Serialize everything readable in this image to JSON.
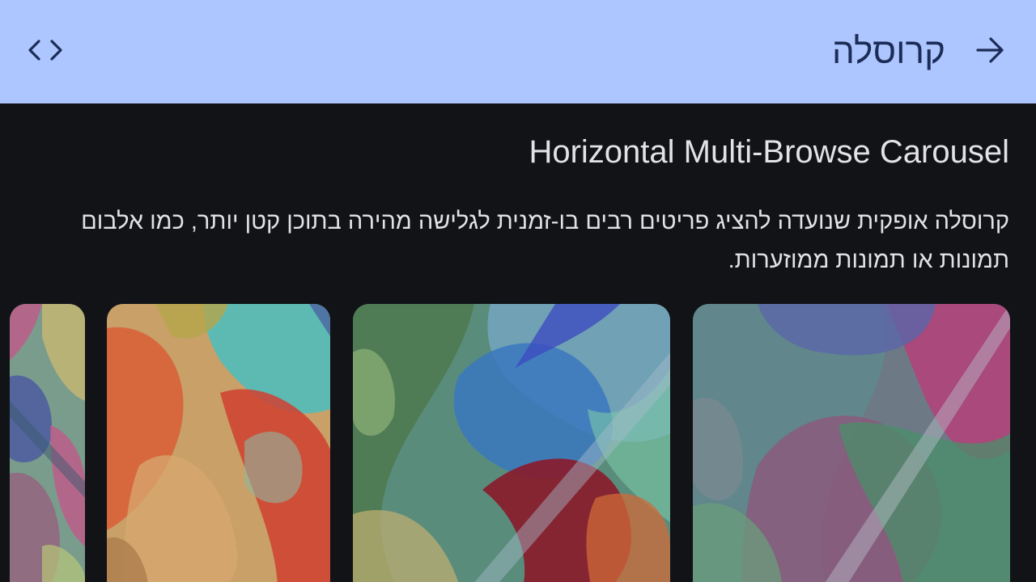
{
  "top_app_bar": {
    "title": "קרוסלה",
    "back_icon": "arrow-forward-icon",
    "code_icon": "code-icon",
    "background_color": "#aec6ff",
    "title_color": "#1b2c56"
  },
  "section": {
    "heading": "Horizontal Multi-Browse Carousel",
    "description": "קרוסלה אופקית שנועדה להציג פריטים רבים בו-זמנית לגלישה מהירה בתוכן קטן יותר, כמו אלבום תמונות או תמונות ממוזערות."
  },
  "carousel": {
    "items": [
      {
        "index": 1,
        "palette": [
          "#6d7a86",
          "#b4417a",
          "#4a8f6a",
          "#5a66a8"
        ]
      },
      {
        "index": 2,
        "palette": [
          "#5a8c7c",
          "#3a78c0",
          "#8a1a2a",
          "#c2b070"
        ]
      },
      {
        "index": 3,
        "palette": [
          "#d8623a",
          "#c8a068",
          "#4abec0",
          "#d04030"
        ]
      },
      {
        "index": 4,
        "palette": [
          "#7a9c8c",
          "#c05a8a",
          "#4a58a0",
          "#c8b870"
        ]
      }
    ]
  },
  "colors": {
    "page_background": "#111316",
    "text_on_dark": "#e3e2e6"
  }
}
